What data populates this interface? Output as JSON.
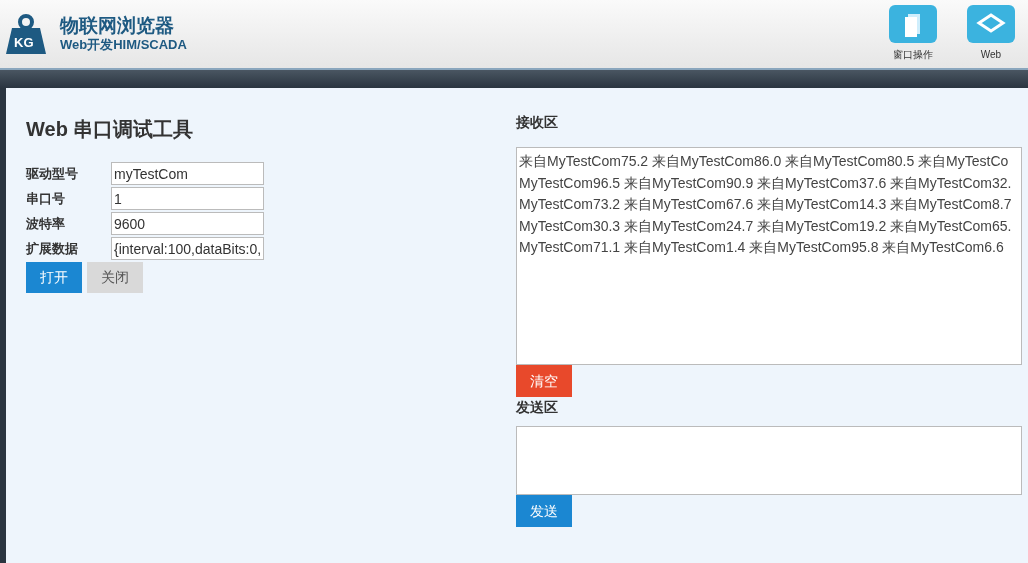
{
  "header": {
    "logo_text": "KG",
    "title": "物联网浏览器",
    "subtitle": "Web开发HIM/SCADA",
    "toolbar": [
      {
        "label": "窗口操作",
        "kind": "window"
      },
      {
        "label": "Web",
        "kind": "web"
      }
    ]
  },
  "tool": {
    "title": "Web 串口调试工具",
    "fields": [
      {
        "label": "驱动型号",
        "value": "myTestCom"
      },
      {
        "label": "串口号",
        "value": "1"
      },
      {
        "label": "波特率",
        "value": "9600"
      },
      {
        "label": "扩展数据",
        "value": "{interval:100,dataBits:0,"
      }
    ],
    "buttons": [
      {
        "label": "打开",
        "kind": "primary"
      },
      {
        "label": "关闭",
        "kind": "secondary"
      }
    ]
  },
  "receive": {
    "title": "接收区",
    "lines": [
      "来自MyTestCom75.2 来自MyTestCom86.0 来自MyTestCom80.5 来自MyTestCo",
      "MyTestCom96.5 来自MyTestCom90.9 来自MyTestCom37.6 来自MyTestCom32.",
      "MyTestCom73.2 来自MyTestCom67.6 来自MyTestCom14.3 来自MyTestCom8.7",
      "MyTestCom30.3 来自MyTestCom24.7 来自MyTestCom19.2 来自MyTestCom65.",
      "MyTestCom71.1 来自MyTestCom1.4 来自MyTestCom95.8 来自MyTestCom6.6"
    ],
    "clear_button": "清空"
  },
  "send": {
    "title": "发送区",
    "send_button": "发送"
  }
}
